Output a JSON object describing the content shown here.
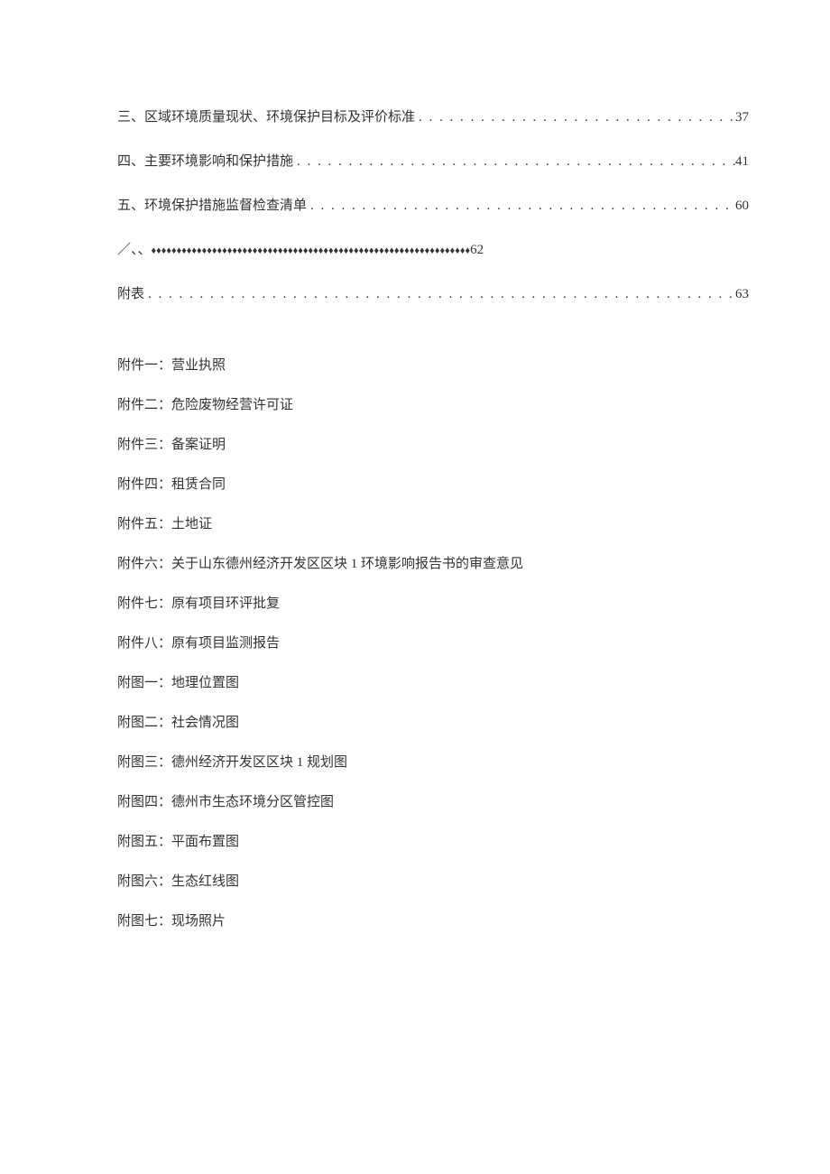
{
  "toc": [
    {
      "label": "三、区域环境质量现状、环境保护目标及评价标准",
      "page": "37"
    },
    {
      "label": "四、主要环境影响和保护措施",
      "page": "41"
    },
    {
      "label": "五、环境保护措施监督检查清单",
      "page": "60"
    }
  ],
  "toc_special": {
    "prefix": "／、、",
    "diamonds": "♦♦♦♦♦♦♦♦♦♦♦♦♦♦♦♦♦♦♦♦♦♦♦♦♦♦♦♦♦♦♦♦♦♦♦♦♦♦♦♦♦♦♦♦♦♦♦♦♦♦♦♦♦♦♦♦♦♦♦♦♦♦♦",
    "page": "62"
  },
  "toc_appendix": {
    "label": "附表",
    "page": "63"
  },
  "dots": ". . . . . . . . . . . . . . . . . . . . . . . . . . . . . . . . . . . . . . . . . . . . . . . . . . . . . . . . . . . . . . . . . . . . . . . . . . . . . . . . . . . . . . . . . . . . . . . . . . . . . . . . . . . . . . . . . . . . . . . . . . . . . . . . . . . . . . . . . . . . . . . . . . . . . . . . . . . . . . . . .",
  "attachments": [
    "附件一：营业执照",
    "附件二：危险废物经营许可证",
    "附件三：备案证明",
    "附件四：租赁合同",
    "附件五：土地证",
    "附件六：关于山东德州经济开发区区块 1 环境影响报告书的审查意见",
    "附件七：原有项目环评批复",
    "附件八：原有项目监测报告",
    "附图一：地理位置图",
    "附图二：社会情况图",
    "附图三：德州经济开发区区块 1 规划图",
    "附图四：德州市生态环境分区管控图",
    "附图五：平面布置图",
    "附图六：生态红线图",
    "附图七：现场照片"
  ]
}
